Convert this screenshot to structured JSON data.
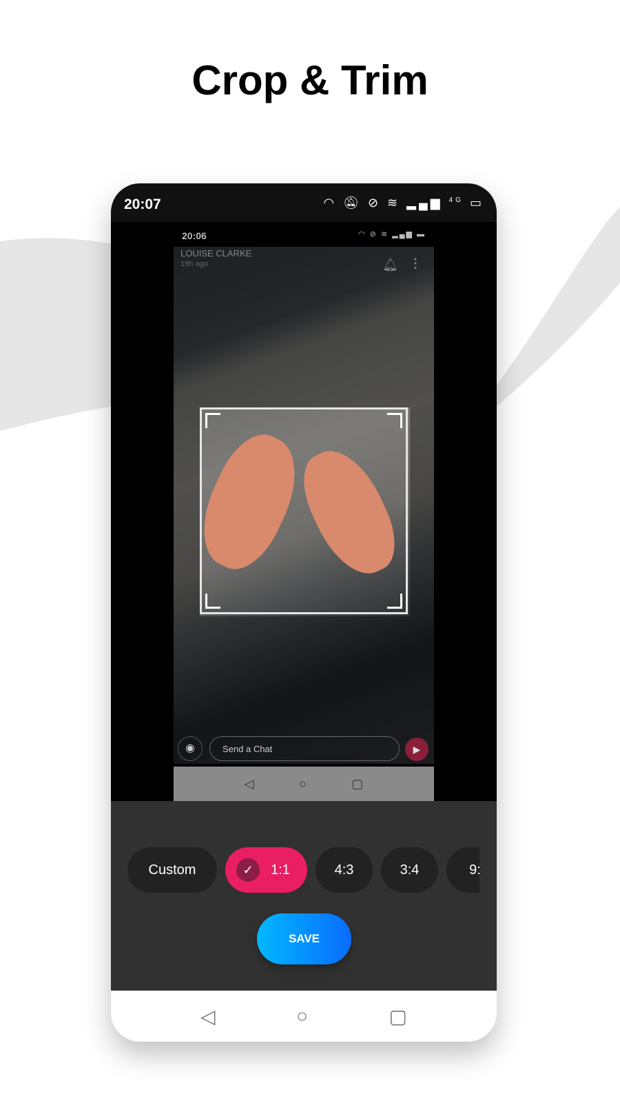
{
  "title": "Crop & Trim",
  "status_bar": {
    "time": "20:07",
    "icons": [
      "headset-icon",
      "bell-off-icon",
      "dnd-icon",
      "wifi-icon",
      "volte-icon",
      "signal-icon",
      "4g-icon",
      "battery-icon"
    ],
    "network": "4G"
  },
  "screenshot": {
    "status_time": "20:06",
    "sender_name": "LOUISE CLARKE",
    "time_ago": "19h ago",
    "chat_placeholder": "Send a Chat"
  },
  "ratios": [
    {
      "label": "Custom",
      "selected": false
    },
    {
      "label": "1:1",
      "selected": true
    },
    {
      "label": "4:3",
      "selected": false
    },
    {
      "label": "3:4",
      "selected": false
    },
    {
      "label": "9:",
      "selected": false
    }
  ],
  "save_label": "SAVE",
  "colors": {
    "accent": "#e91e63",
    "save_start": "#00b8ff",
    "save_end": "#0a6cff",
    "panel": "#313131"
  }
}
